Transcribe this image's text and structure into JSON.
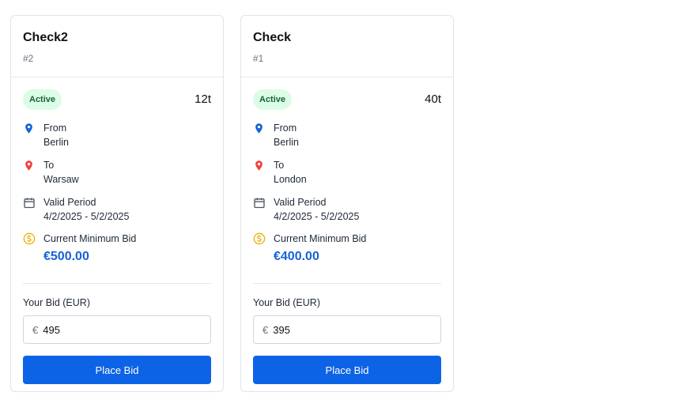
{
  "colors": {
    "primary": "#0d63e6",
    "price": "#1662d6",
    "badge_bg": "#dcfce7",
    "badge_text": "#166534",
    "from_pin": "#1565d8",
    "to_pin": "#ef4444",
    "coin": "#eab308"
  },
  "cards": [
    {
      "title": "Check2",
      "id": "#2",
      "status": "Active",
      "weight": "12t",
      "from_label": "From",
      "from": "Berlin",
      "to_label": "To",
      "to": "Warsaw",
      "period_label": "Valid Period",
      "period": "4/2/2025 - 5/2/2025",
      "min_bid_label": "Current Minimum Bid",
      "min_bid": "€500.00",
      "your_bid_label": "Your Bid (EUR)",
      "currency_symbol": "€",
      "bid_value": "495",
      "button_label": "Place Bid"
    },
    {
      "title": "Check",
      "id": "#1",
      "status": "Active",
      "weight": "40t",
      "from_label": "From",
      "from": "Berlin",
      "to_label": "To",
      "to": "London",
      "period_label": "Valid Period",
      "period": "4/2/2025 - 5/2/2025",
      "min_bid_label": "Current Minimum Bid",
      "min_bid": "€400.00",
      "your_bid_label": "Your Bid (EUR)",
      "currency_symbol": "€",
      "bid_value": "395",
      "button_label": "Place Bid"
    }
  ]
}
